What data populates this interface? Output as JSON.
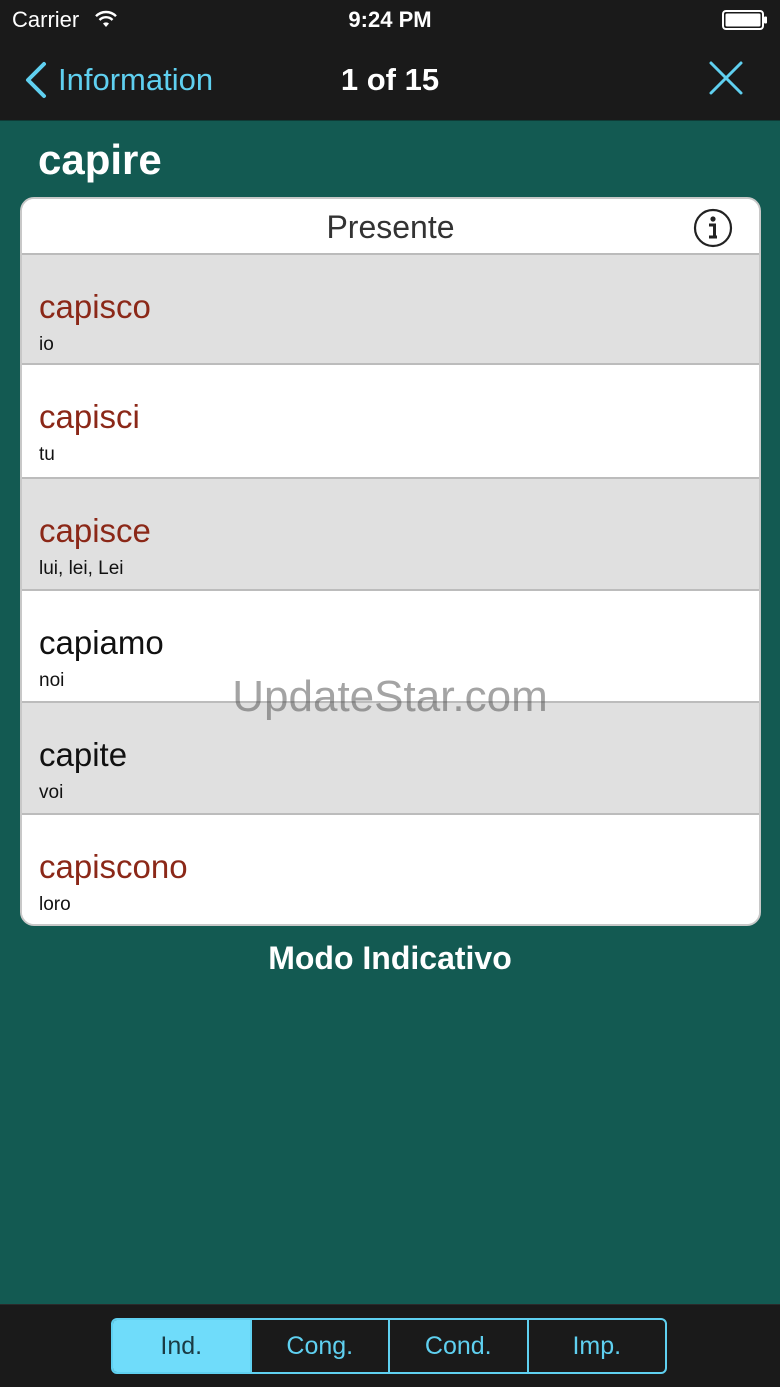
{
  "status_bar": {
    "carrier": "Carrier",
    "time": "9:24 PM"
  },
  "nav": {
    "back_label": "Information",
    "counter": "1 of 15"
  },
  "verb": "capire",
  "table": {
    "tense": "Presente",
    "rows": [
      {
        "form": "capisco",
        "pronoun": "io",
        "irregular": true
      },
      {
        "form": "capisci",
        "pronoun": "tu",
        "irregular": true
      },
      {
        "form": "capisce",
        "pronoun": "lui, lei, Lei",
        "irregular": true
      },
      {
        "form": "capiamo",
        "pronoun": "noi",
        "irregular": false
      },
      {
        "form": "capite",
        "pronoun": "voi",
        "irregular": false
      },
      {
        "form": "capiscono",
        "pronoun": "loro",
        "irregular": true
      }
    ]
  },
  "watermark": "UpdateStar.com",
  "mood": "Modo Indicativo",
  "segments": [
    "Ind.",
    "Cong.",
    "Cond.",
    "Imp."
  ],
  "active_segment": "Ind.",
  "colors": {
    "background": "#135a52",
    "bar": "#1a1a1a",
    "accent": "#5fd0f0",
    "irregular_text": "#8b2818"
  }
}
